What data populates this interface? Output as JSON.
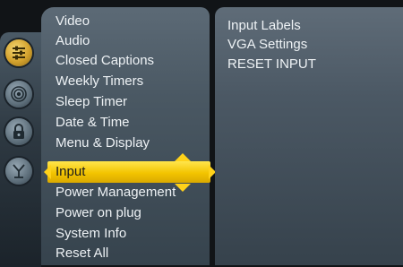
{
  "side_icons": [
    {
      "name": "setup-icon",
      "active": true
    },
    {
      "name": "broadcast-icon",
      "active": false
    },
    {
      "name": "lock-icon",
      "active": false
    },
    {
      "name": "antenna-icon",
      "active": false
    }
  ],
  "menu": {
    "items": [
      "Video",
      "Audio",
      "Closed Captions",
      "Weekly Timers",
      "Sleep Timer",
      "Date & Time",
      "Menu & Display",
      "Input",
      "Power Management",
      "Power on plug",
      "System Info",
      "Reset All"
    ],
    "selected_label": "Input"
  },
  "submenu": {
    "items": [
      "Input Labels",
      "VGA Settings",
      "RESET INPUT"
    ]
  },
  "colors": {
    "highlight": "#f3c400",
    "text": "#eef2f5",
    "panel": "#4a5863"
  }
}
